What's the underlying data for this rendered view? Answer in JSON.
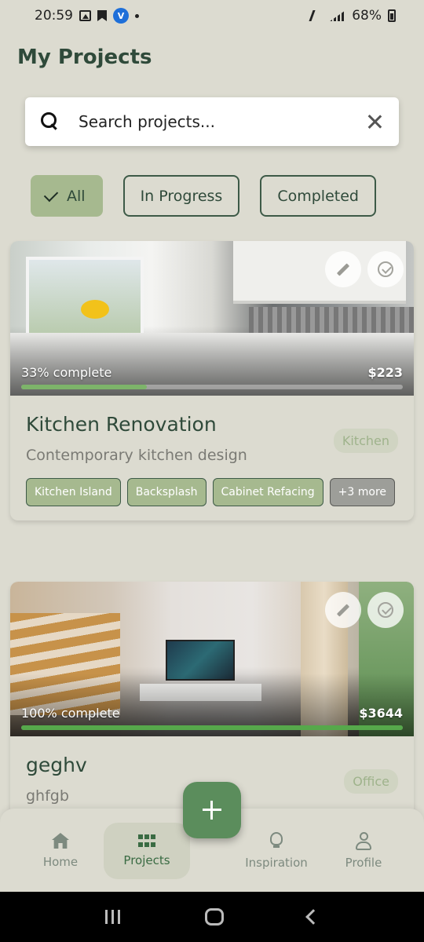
{
  "status_bar": {
    "time": "20:59",
    "battery": "68%"
  },
  "header": {
    "title": "My Projects"
  },
  "search": {
    "placeholder": "Search projects..."
  },
  "filters": [
    {
      "label": "All",
      "active": true
    },
    {
      "label": "In Progress",
      "active": false
    },
    {
      "label": "Completed",
      "active": false
    }
  ],
  "projects": [
    {
      "progress_text": "33% complete",
      "progress": 0.33,
      "price": "$223",
      "title": "Kitchen Renovation",
      "category": "Kitchen",
      "description": "Contemporary kitchen design",
      "tags": [
        "Kitchen Island",
        "Backsplash",
        "Cabinet Refacing"
      ],
      "more": "+3 more"
    },
    {
      "progress_text": "100% complete",
      "progress": 1.0,
      "price": "$3644",
      "title": "geghv",
      "category": "Office",
      "description": "ghfgb"
    }
  ],
  "bottom_nav": [
    {
      "label": "Home",
      "icon": "home-icon"
    },
    {
      "label": "Projects",
      "icon": "grid-icon",
      "active": true
    },
    {
      "label": "Inspiration",
      "icon": "lightbulb-icon"
    },
    {
      "label": "Profile",
      "icon": "person-icon"
    }
  ],
  "colors": {
    "accent": "#5b8d5c",
    "chip_active": "#a6b98f",
    "background": "#dcdbd0"
  }
}
